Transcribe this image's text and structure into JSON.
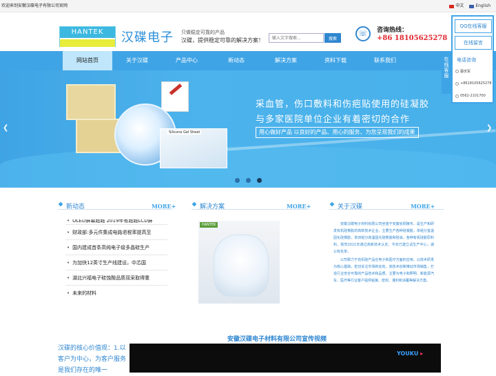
{
  "topbar": {
    "welcome": "欢迎来到安徽汉碟电子有限公司官网",
    "lang_cn": "中文",
    "lang_en": "English"
  },
  "header": {
    "logo_en": "HANTEK",
    "logo_cn": "汉碟电子",
    "slogan1": "只做稳定可靠的产品",
    "slogan2": "汉碟，提供稳定可靠的解决方案！",
    "search_placeholder": "输入文字搜索...",
    "search_button": "搜索",
    "hotline_label": "咨询热线：",
    "hotline_number": "+86 18105625278"
  },
  "nav": {
    "items": [
      "网站首页",
      "关于汉碟",
      "产品中心",
      "新动态",
      "解决方案",
      "资料下载",
      "联系我们"
    ]
  },
  "banner": {
    "title1": "采血管，伤口敷料和伤疤贴使用的硅凝胶",
    "title2": "与多家医院单位企业有着密切的合作",
    "tagline": "用心做好产品 以良好的产品、用心的服务、为您呈现我们的成果",
    "sheet_label": "Silicone Gel Sheet"
  },
  "side_panel": {
    "tab": "在线客服",
    "qq": "QQ在线客服",
    "message": "在线留言",
    "phone_title": "电话咨询",
    "contact": "蔡庆军",
    "mobile": "+8618105625278",
    "tel": "0562-2101700"
  },
  "sections": {
    "news_title": "新动态",
    "solutions_title": "解决方案",
    "about_title": "关于汉碟",
    "more": "MORE+",
    "news": [
      "OLED屏幕超越 2019年有超越LCD屏",
      "财政部:多元件集成电路退税率提高至",
      "国内建成首条高纯电子级多晶硅生产",
      "为加快12英寸生产线建设，中芯国",
      "湖北兴福电子硅蚀酸品质双采取得重",
      "未来的材料"
    ],
    "solution_label": "HANTEK",
    "about_p1": "安徽汉碟电子材料有限公司坐落于安徽省铜陵市，是生产和研发有机硅橡胶的高新技术企业，主要生产各种硅凝胶，单组分室温固化硅橡胶，单双组分高温固化硅橡胶和硅油，各种有机硅胶原料料。我司2021年通过高新技术认定，今年已建立试生产中心，诚公有名单。",
    "about_p2": "公司致力于有机硅产品在电子和医疗方面的应用，以技术研发为核心基础，密切关注市场新动向，高技术创新推动市场销售，打造行业安全可靠的产品技术和品质。主要为电子和照明、新能源汽车、医疗等行业客户提供粘接、密封、灌封和涂覆等解决方案。"
  },
  "video": {
    "title": "安徽汉碟电子材料有限公司宣传视频",
    "core_values": "汉碟的核心价值观：1.以客户为中心，为客户服务是我们存在的唯一",
    "brand": "YOUKU"
  }
}
